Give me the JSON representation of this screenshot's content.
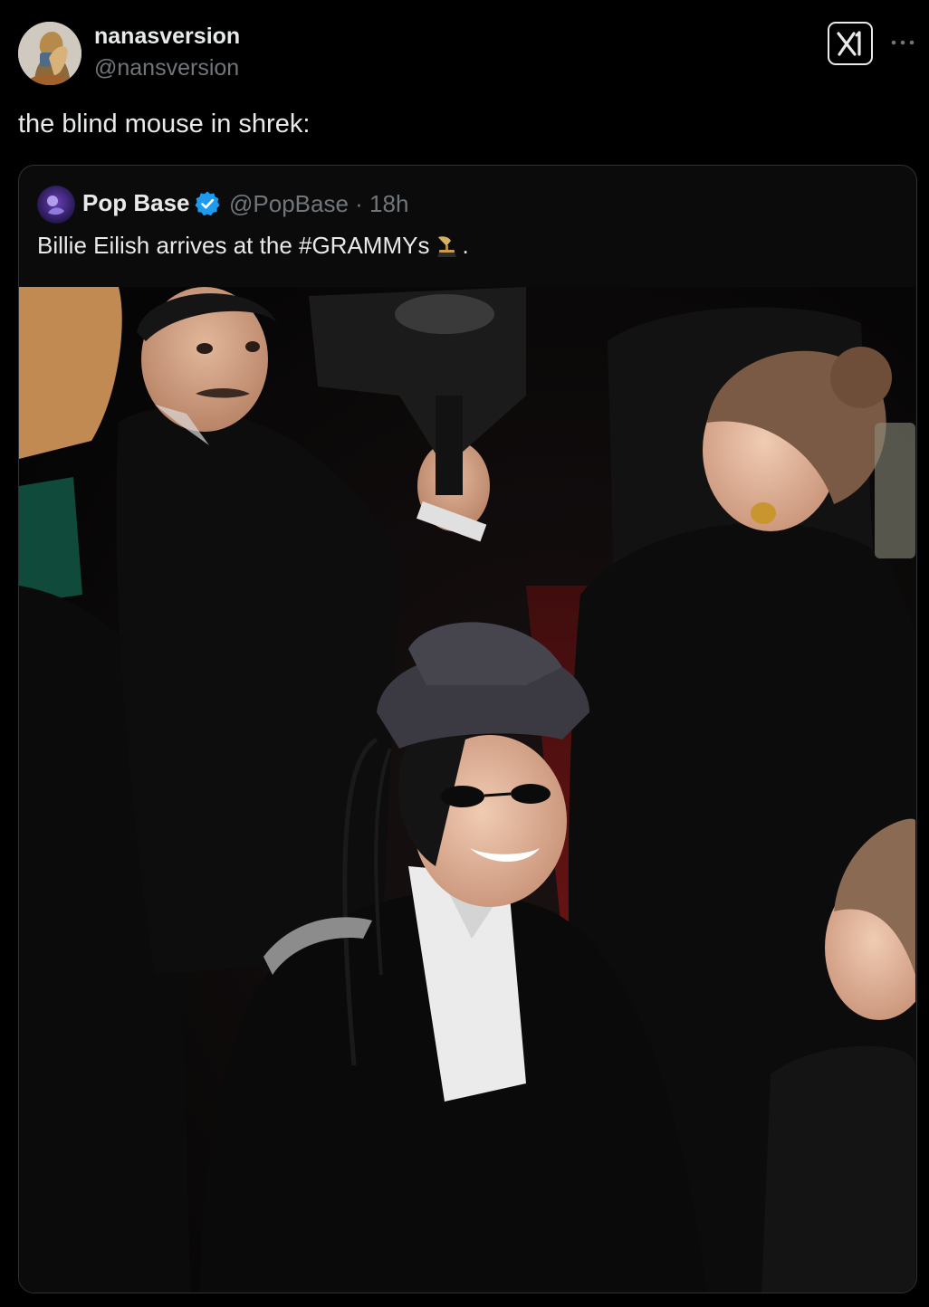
{
  "post": {
    "author": {
      "display_name": "nanasversion",
      "handle": "@nansversion"
    },
    "text": "the blind mouse in shrek:",
    "icons": {
      "avatar": "user-avatar",
      "x_logo": "x-logo-icon",
      "more": "more-dots-icon"
    }
  },
  "quote": {
    "author": {
      "display_name": "Pop Base",
      "handle_time": "@PopBase · 18h",
      "verified": true
    },
    "text": "Billie Eilish arrives at the #GRAMMYs",
    "text_suffix": ".",
    "emoji": "gramophone-trophy-icon",
    "media": "photo"
  },
  "colors": {
    "background": "#000000",
    "text_primary": "#e7e9ea",
    "text_secondary": "#71767b",
    "border": "#2f3336",
    "verified_blue": "#1d9bf0"
  }
}
